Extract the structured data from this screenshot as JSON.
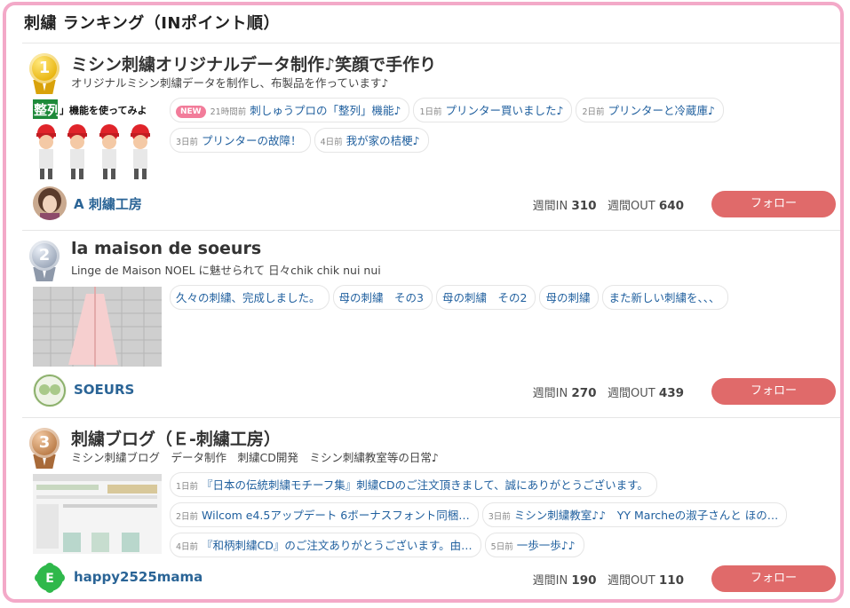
{
  "header": {
    "title": "刺繍 ランキング（INポイント順）"
  },
  "stats_labels": {
    "in": "週間IN",
    "out": "週間OUT"
  },
  "follow_label": "フォロー",
  "new_badge": "NEW",
  "entries": [
    {
      "rank": "1",
      "medal": "gold",
      "title": "ミシン刺繍オリジナルデータ制作♪笑顔で手作り",
      "subtitle": "オリジナルミシン刺繍データを制作し、布製品を作っています♪",
      "thumb_text": "整列」機能を使ってみよ",
      "posts": [
        {
          "ago": "21時間前",
          "text": "刺しゅうプロの「整列」機能♪",
          "is_new": true
        },
        {
          "ago": "1日前",
          "text": "プリンター買いました♪"
        },
        {
          "ago": "2日前",
          "text": "プリンターと冷蔵庫♪"
        },
        {
          "ago": "3日前",
          "text": "プリンターの故障！"
        },
        {
          "ago": "4日前",
          "text": "我が家の桔梗♪"
        }
      ],
      "author": "A 刺繍工房",
      "weekly_in": "310",
      "weekly_out": "640"
    },
    {
      "rank": "2",
      "medal": "silver",
      "title": "la maison de soeurs",
      "subtitle": "Linge de Maison NOEL に魅せられて 日々chik chik nui nui",
      "posts": [
        {
          "ago": "",
          "text": "久々の刺繍、完成しました。"
        },
        {
          "ago": "",
          "text": "母の刺繍　その3"
        },
        {
          "ago": "",
          "text": "母の刺繍　その2"
        },
        {
          "ago": "",
          "text": "母の刺繍"
        },
        {
          "ago": "",
          "text": "また新しい刺繍を、、、"
        }
      ],
      "author": "SOEURS",
      "weekly_in": "270",
      "weekly_out": "439"
    },
    {
      "rank": "3",
      "medal": "bronze",
      "title": "刺繍ブログ（Ｅ-刺繍工房）",
      "subtitle": "ミシン刺繍ブログ　データ制作　刺繍CD開発　ミシン刺繍教室等の日常♪",
      "posts": [
        {
          "ago": "1日前",
          "text": "『日本の伝統刺繍モチーフ集』刺繍CDのご注文頂きまして、誠にありがとうございます。"
        },
        {
          "ago": "2日前",
          "text": "Wilcom e4.5アップデート 6ボーナスフォント同梱…"
        },
        {
          "ago": "3日前",
          "text": "ミシン刺繍教室♪♪　YY Marcheの淑子さんと ほの…"
        },
        {
          "ago": "4日前",
          "text": "『和柄刺繍CD』のご注文ありがとうございます。由…"
        },
        {
          "ago": "5日前",
          "text": "一歩一歩♪♪"
        }
      ],
      "author": "happy2525mama",
      "weekly_in": "190",
      "weekly_out": "110"
    }
  ]
}
